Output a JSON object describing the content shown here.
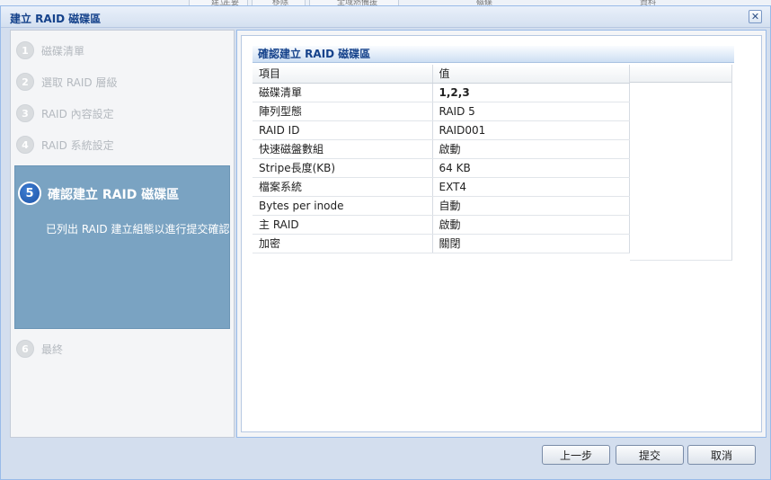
{
  "background": {
    "toolbar_items": [
      "建立",
      "移除",
      "全域熱備援"
    ],
    "column_headers": [
      "主要",
      "磁碟",
      "資料"
    ]
  },
  "dialog": {
    "title": "建立 RAID 磁碟區",
    "close_symbol": "✕"
  },
  "steps": [
    {
      "num": "1",
      "label": "磁碟清單"
    },
    {
      "num": "2",
      "label": "選取 RAID 層級"
    },
    {
      "num": "3",
      "label": "RAID 內容設定"
    },
    {
      "num": "4",
      "label": "RAID 系統設定"
    },
    {
      "num": "5",
      "label": "確認建立 RAID 磁碟區",
      "description": "已列出 RAID 建立組態以進行提交確認",
      "active": true
    },
    {
      "num": "6",
      "label": "最終"
    }
  ],
  "summary": {
    "title": "確認建立 RAID 磁碟區",
    "headers": [
      "項目",
      "值"
    ],
    "rows": [
      {
        "item": "磁碟清單",
        "value": "1,2,3",
        "bold": true
      },
      {
        "item": "陣列型態",
        "value": "RAID 5"
      },
      {
        "item": "RAID ID",
        "value": "RAID001"
      },
      {
        "item": "快速磁盤數組",
        "value": "啟動"
      },
      {
        "item": "Stripe長度(KB)",
        "value": "64 KB"
      },
      {
        "item": "檔案系統",
        "value": "EXT4"
      },
      {
        "item": "Bytes per inode",
        "value": "自動"
      },
      {
        "item": "主 RAID",
        "value": "啟動"
      },
      {
        "item": "加密",
        "value": "關閉"
      }
    ]
  },
  "buttons": {
    "back": "上一步",
    "submit": "提交",
    "cancel": "取消"
  },
  "colors": {
    "accent": "#15428b",
    "active_step_bg": "#7aa3c2",
    "border": "#99bbe8"
  }
}
